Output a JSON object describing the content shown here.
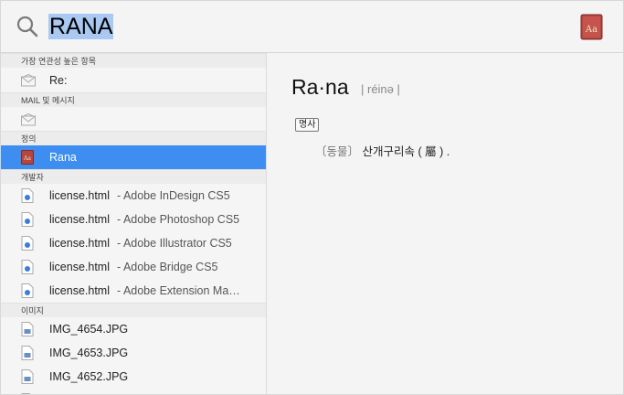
{
  "search": {
    "query": "RANA"
  },
  "sections": {
    "top_hits": "가장 연관성 높은 항목",
    "mail": "MAIL 및 메시지",
    "definition": "정의",
    "developer": "개발자",
    "images": "이미지"
  },
  "results": {
    "top_hit": {
      "title": "Re:",
      "icon": "envelope-icon"
    },
    "mail_item": {
      "title": "",
      "icon": "envelope-icon"
    },
    "definition_item": {
      "title": "Rana",
      "icon": "dictionary-icon"
    },
    "developer_items": [
      {
        "title": "license.html",
        "sub": "- Adobe InDesign CS5"
      },
      {
        "title": "license.html",
        "sub": "- Adobe Photoshop CS5"
      },
      {
        "title": "license.html",
        "sub": "- Adobe Illustrator CS5"
      },
      {
        "title": "license.html",
        "sub": "- Adobe Bridge CS5"
      },
      {
        "title": "license.html",
        "sub": "- Adobe Extension Ma…"
      }
    ],
    "image_items": [
      {
        "title": "IMG_4654.JPG"
      },
      {
        "title": "IMG_4653.JPG"
      },
      {
        "title": "IMG_4652.JPG"
      }
    ]
  },
  "preview": {
    "word": "Ra·na",
    "pronunciation": "| réinə |",
    "part_of_speech": "명사",
    "domain": "〔동물〕",
    "definition": "산개구리속 ( 屬 ) ."
  },
  "colors": {
    "selection": "#3d8ef0",
    "search_highlight": "#a9c9f3",
    "dictionary_red": "#b5453e"
  }
}
